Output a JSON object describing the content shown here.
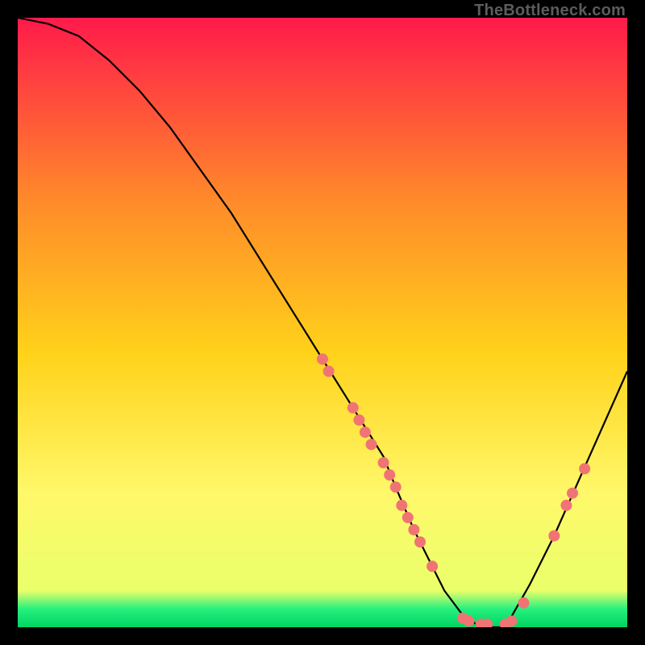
{
  "watermark": "TheBottleneck.com",
  "colors": {
    "gradient_top": "#ff1a4b",
    "gradient_mid_upper": "#ff6a2a",
    "gradient_mid": "#ffd21a",
    "gradient_lower": "#fff86a",
    "gradient_green": "#26f07e",
    "gradient_bottom": "#00d463",
    "curve": "#000000",
    "marker": "#f07474",
    "bg": "#000000"
  },
  "chart_data": {
    "type": "line",
    "title": "",
    "xlabel": "",
    "ylabel": "",
    "xlim": [
      0,
      100
    ],
    "ylim": [
      0,
      100
    ],
    "grid": false,
    "legend": false,
    "series": [
      {
        "name": "bottleneck-curve",
        "x": [
          0,
          5,
          10,
          15,
          20,
          25,
          30,
          35,
          40,
          45,
          50,
          55,
          60,
          62,
          65,
          68,
          70,
          73,
          76,
          80,
          84,
          88,
          92,
          96,
          100
        ],
        "y": [
          100,
          99,
          97,
          93,
          88,
          82,
          75,
          68,
          60,
          52,
          44,
          36,
          28,
          23,
          16,
          10,
          6,
          2,
          0,
          0,
          7,
          15,
          24,
          33,
          42
        ]
      }
    ],
    "markers": [
      {
        "x": 50,
        "y": 44
      },
      {
        "x": 51,
        "y": 42
      },
      {
        "x": 55,
        "y": 36
      },
      {
        "x": 56,
        "y": 34
      },
      {
        "x": 57,
        "y": 32
      },
      {
        "x": 58,
        "y": 30
      },
      {
        "x": 60,
        "y": 27
      },
      {
        "x": 61,
        "y": 25
      },
      {
        "x": 62,
        "y": 23
      },
      {
        "x": 63,
        "y": 20
      },
      {
        "x": 64,
        "y": 18
      },
      {
        "x": 65,
        "y": 16
      },
      {
        "x": 66,
        "y": 14
      },
      {
        "x": 68,
        "y": 10
      },
      {
        "x": 73,
        "y": 1.5
      },
      {
        "x": 74,
        "y": 1
      },
      {
        "x": 76,
        "y": 0.5
      },
      {
        "x": 77,
        "y": 0.5
      },
      {
        "x": 80,
        "y": 0.5
      },
      {
        "x": 81,
        "y": 1
      },
      {
        "x": 83,
        "y": 4
      },
      {
        "x": 88,
        "y": 15
      },
      {
        "x": 90,
        "y": 20
      },
      {
        "x": 91,
        "y": 22
      },
      {
        "x": 93,
        "y": 26
      }
    ]
  }
}
